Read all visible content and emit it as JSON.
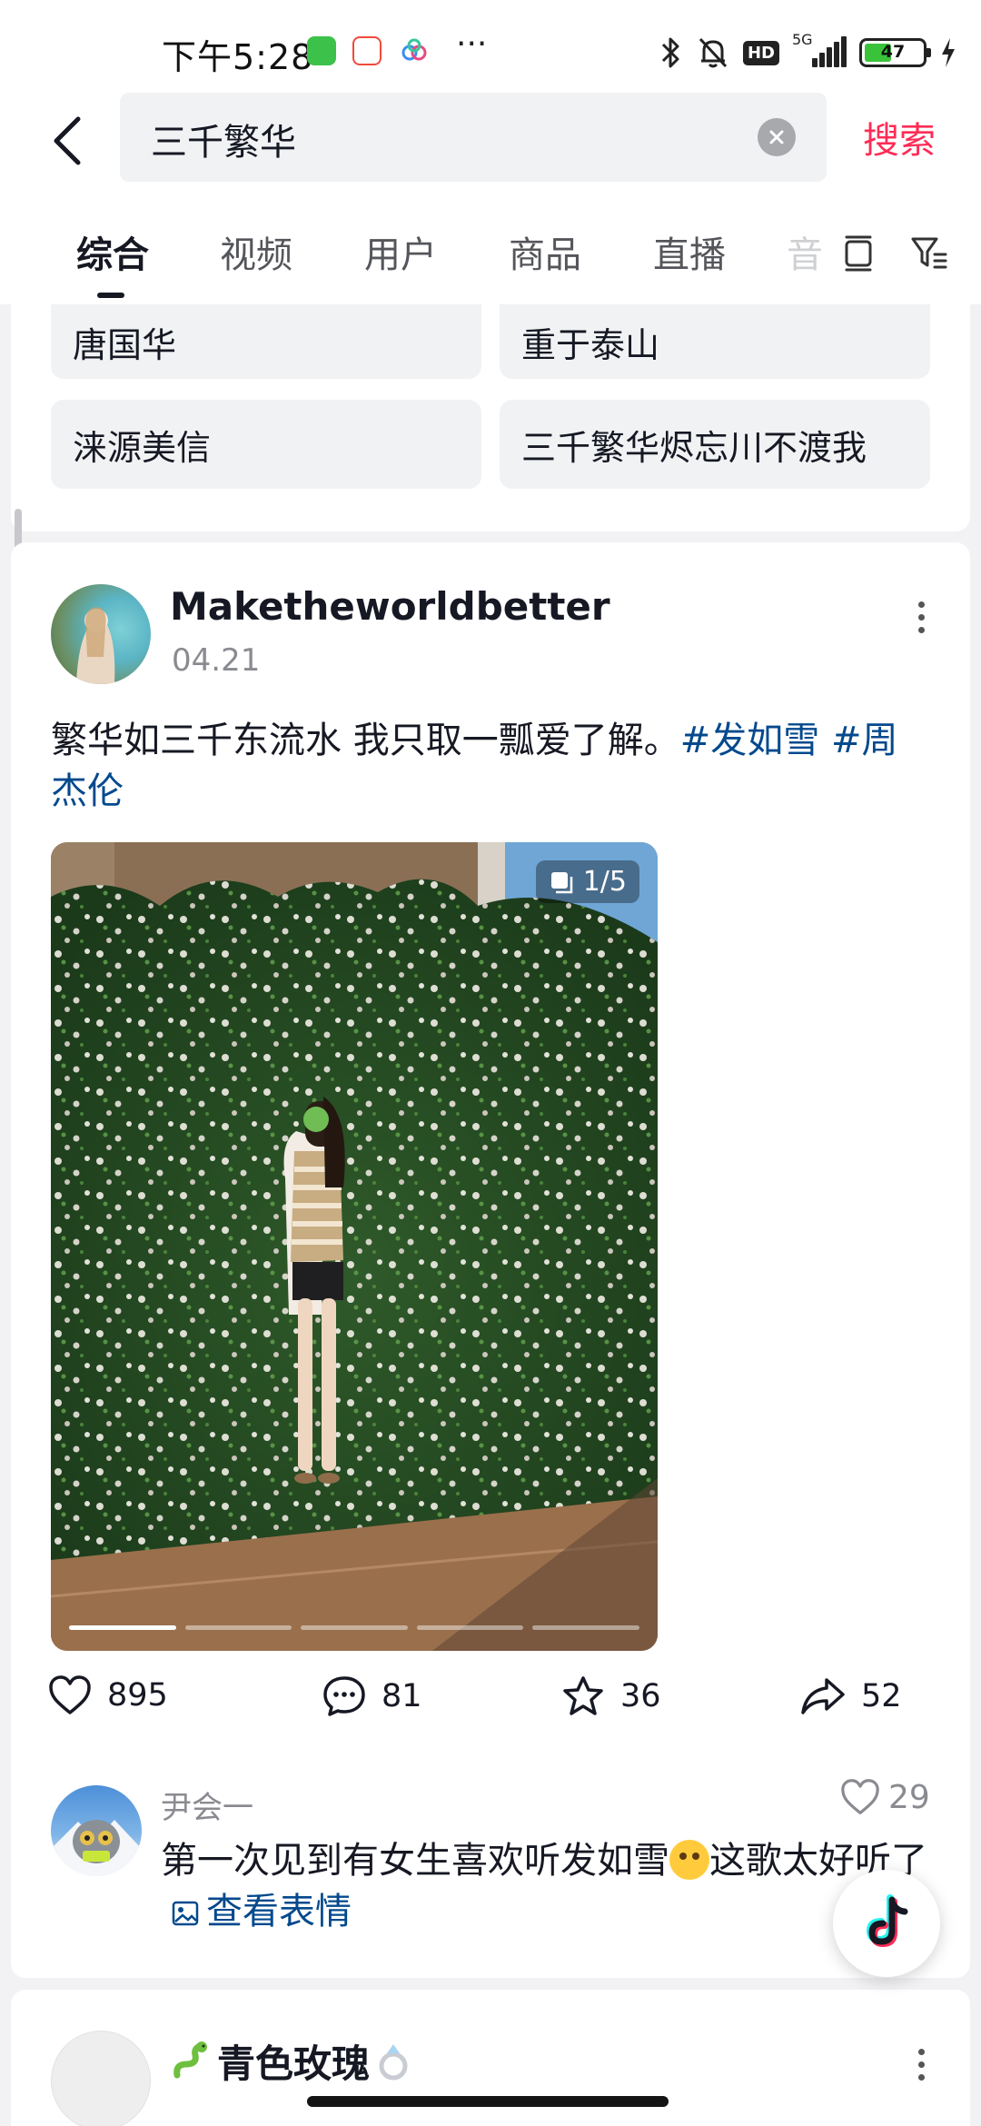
{
  "status_bar": {
    "time": "下午5:28",
    "network": "5G",
    "battery": "47",
    "battery_level": 0.47,
    "icons": [
      "app-notification-icon",
      "58-app-icon",
      "cloud-app-icon",
      "bluetooth-icon",
      "mute-bell-icon",
      "hd-icon",
      "signal-icon",
      "battery-icon",
      "charging-icon"
    ]
  },
  "search": {
    "query": "三千繁华",
    "submit_label": "搜索"
  },
  "tabs": [
    {
      "label": "综合",
      "active": true
    },
    {
      "label": "视频"
    },
    {
      "label": "用户"
    },
    {
      "label": "商品"
    },
    {
      "label": "直播"
    },
    {
      "label": "音"
    }
  ],
  "related_searches": [
    "唐国华",
    "重于泰山",
    "涞源美信",
    "三千繁华烬忘川不渡我"
  ],
  "post": {
    "author": "Maketheworldbetter",
    "date": "04.21",
    "caption": "繁华如三千东流水 我只取一瓢爱了解。",
    "hashtags": [
      "#发如雪",
      "#周杰伦"
    ],
    "image_counter": "1/5",
    "image_pages": 5,
    "current_page": 1,
    "likes": "895",
    "comments": "81",
    "favorites": "36",
    "shares": "52"
  },
  "top_comment": {
    "user": "尹会一",
    "likes": "29",
    "text_before": "第一次见到有女生喜欢听发如雪",
    "emoji": "crying-face-emoji",
    "text_after": "这歌太好听了",
    "link": "查看表情"
  },
  "next_post": {
    "author": "青色玫瑰",
    "prefix_emoji": "snake-emoji",
    "suffix_emoji": "ring-emoji"
  },
  "colors": {
    "accent": "#fe2c55",
    "hashtag": "#04498d",
    "muted_text": "#8a8b91",
    "background": "#f2f2f4"
  }
}
